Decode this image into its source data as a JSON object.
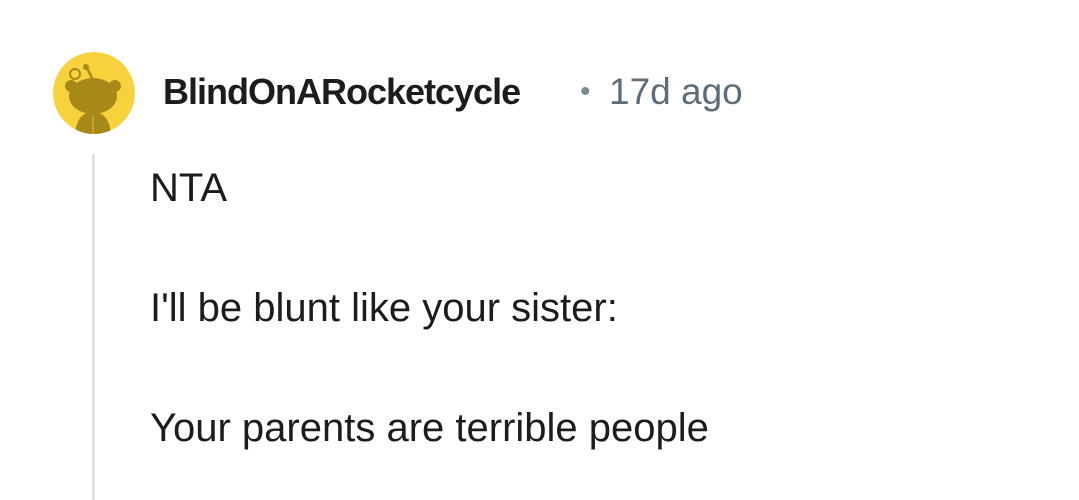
{
  "comment": {
    "author": "BlindOnARocketcycle",
    "separator": "•",
    "timestamp": "17d ago",
    "avatar_icon": "snoo-avatar-icon",
    "avatar_color": "#f7d23d",
    "body": [
      "NTA",
      "I'll be blunt like your sister:",
      "Your parents are terrible people"
    ]
  }
}
